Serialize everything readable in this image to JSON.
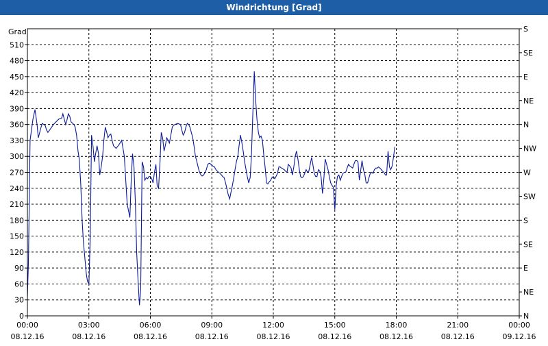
{
  "window": {
    "title": "Windrichtung [Grad]"
  },
  "colors": {
    "title_bar": "#1e5ea6",
    "line": "#0a1a9a",
    "grid": "#000000"
  },
  "chart_data": {
    "type": "line",
    "title": "Windrichtung [Grad]",
    "ylabel": "Grad",
    "ylim": [
      0,
      540
    ],
    "y_ticks": [
      0,
      30,
      60,
      90,
      120,
      150,
      180,
      210,
      240,
      270,
      300,
      330,
      360,
      390,
      420,
      450,
      480,
      510
    ],
    "y2_ticks": [
      {
        "value": 0,
        "label": "N"
      },
      {
        "value": 45,
        "label": "NE"
      },
      {
        "value": 90,
        "label": "E"
      },
      {
        "value": 135,
        "label": "SE"
      },
      {
        "value": 180,
        "label": "S"
      },
      {
        "value": 225,
        "label": "SW"
      },
      {
        "value": 270,
        "label": "W"
      },
      {
        "value": 315,
        "label": "NW"
      },
      {
        "value": 360,
        "label": "N"
      },
      {
        "value": 405,
        "label": "NE"
      },
      {
        "value": 450,
        "label": "E"
      },
      {
        "value": 495,
        "label": "SE"
      },
      {
        "value": 540,
        "label": "S"
      }
    ],
    "xlim": [
      0,
      24
    ],
    "x_ticks": [
      {
        "value": 0,
        "time": "00:00",
        "date": "08.12.16"
      },
      {
        "value": 3,
        "time": "03:00",
        "date": "08.12.16"
      },
      {
        "value": 6,
        "time": "06:00",
        "date": "08.12.16"
      },
      {
        "value": 9,
        "time": "09:00",
        "date": "08.12.16"
      },
      {
        "value": 12,
        "time": "12:00",
        "date": "08.12.16"
      },
      {
        "value": 15,
        "time": "15:00",
        "date": "08.12.16"
      },
      {
        "value": 18,
        "time": "18:00",
        "date": "08.12.16"
      },
      {
        "value": 21,
        "time": "21:00",
        "date": "08.12.16"
      },
      {
        "value": 24,
        "time": "00:00",
        "date": "09.12.16"
      }
    ],
    "grid": true,
    "series": [
      {
        "values": [
          [
            0.0,
            35
          ],
          [
            0.05,
            100
          ],
          [
            0.13,
            330
          ],
          [
            0.27,
            370
          ],
          [
            0.37,
            388
          ],
          [
            0.47,
            360
          ],
          [
            0.53,
            335
          ],
          [
            0.67,
            355
          ],
          [
            0.73,
            362
          ],
          [
            0.87,
            358
          ],
          [
            0.93,
            350
          ],
          [
            1.0,
            345
          ],
          [
            1.13,
            352
          ],
          [
            1.27,
            360
          ],
          [
            1.4,
            365
          ],
          [
            1.53,
            370
          ],
          [
            1.67,
            372
          ],
          [
            1.73,
            380
          ],
          [
            1.8,
            370
          ],
          [
            1.87,
            360
          ],
          [
            1.93,
            368
          ],
          [
            2.0,
            380
          ],
          [
            2.07,
            375
          ],
          [
            2.13,
            365
          ],
          [
            2.27,
            360
          ],
          [
            2.33,
            355
          ],
          [
            2.4,
            340
          ],
          [
            2.47,
            310
          ],
          [
            2.53,
            295
          ],
          [
            2.6,
            250
          ],
          [
            2.67,
            180
          ],
          [
            2.73,
            140
          ],
          [
            2.8,
            110
          ],
          [
            2.87,
            80
          ],
          [
            2.93,
            65
          ],
          [
            3.0,
            60
          ],
          [
            3.07,
            150
          ],
          [
            3.13,
            340
          ],
          [
            3.2,
            320
          ],
          [
            3.27,
            290
          ],
          [
            3.33,
            305
          ],
          [
            3.4,
            320
          ],
          [
            3.47,
            305
          ],
          [
            3.53,
            265
          ],
          [
            3.6,
            280
          ],
          [
            3.67,
            300
          ],
          [
            3.73,
            330
          ],
          [
            3.8,
            355
          ],
          [
            3.87,
            345
          ],
          [
            3.93,
            335
          ],
          [
            4.0,
            340
          ],
          [
            4.07,
            342
          ],
          [
            4.13,
            330
          ],
          [
            4.2,
            320
          ],
          [
            4.33,
            315
          ],
          [
            4.47,
            322
          ],
          [
            4.6,
            330
          ],
          [
            4.73,
            300
          ],
          [
            4.87,
            210
          ],
          [
            5.0,
            185
          ],
          [
            5.07,
            260
          ],
          [
            5.13,
            305
          ],
          [
            5.2,
            280
          ],
          [
            5.27,
            210
          ],
          [
            5.33,
            120
          ],
          [
            5.4,
            65
          ],
          [
            5.47,
            20
          ],
          [
            5.53,
            50
          ],
          [
            5.6,
            290
          ],
          [
            5.67,
            280
          ],
          [
            5.73,
            255
          ],
          [
            5.8,
            260
          ],
          [
            5.87,
            258
          ],
          [
            5.93,
            262
          ],
          [
            6.0,
            262
          ],
          [
            6.07,
            258
          ],
          [
            6.13,
            250
          ],
          [
            6.2,
            270
          ],
          [
            6.27,
            285
          ],
          [
            6.33,
            245
          ],
          [
            6.4,
            240
          ],
          [
            6.47,
            290
          ],
          [
            6.53,
            345
          ],
          [
            6.6,
            335
          ],
          [
            6.67,
            310
          ],
          [
            6.73,
            320
          ],
          [
            6.8,
            335
          ],
          [
            6.87,
            330
          ],
          [
            6.93,
            325
          ],
          [
            7.0,
            340
          ],
          [
            7.07,
            355
          ],
          [
            7.13,
            358
          ],
          [
            7.2,
            360
          ],
          [
            7.33,
            362
          ],
          [
            7.47,
            360
          ],
          [
            7.53,
            350
          ],
          [
            7.6,
            340
          ],
          [
            7.67,
            345
          ],
          [
            7.73,
            355
          ],
          [
            7.8,
            362
          ],
          [
            7.87,
            360
          ],
          [
            7.93,
            355
          ],
          [
            8.0,
            345
          ],
          [
            8.07,
            335
          ],
          [
            8.13,
            320
          ],
          [
            8.2,
            300
          ],
          [
            8.27,
            290
          ],
          [
            8.33,
            280
          ],
          [
            8.4,
            270
          ],
          [
            8.47,
            265
          ],
          [
            8.53,
            263
          ],
          [
            8.6,
            265
          ],
          [
            8.67,
            270
          ],
          [
            8.73,
            275
          ],
          [
            8.8,
            285
          ],
          [
            8.87,
            287
          ],
          [
            8.93,
            286
          ],
          [
            9.0,
            283
          ],
          [
            9.13,
            280
          ],
          [
            9.2,
            275
          ],
          [
            9.27,
            272
          ],
          [
            9.33,
            270
          ],
          [
            9.4,
            268
          ],
          [
            9.47,
            265
          ],
          [
            9.53,
            262
          ],
          [
            9.6,
            260
          ],
          [
            9.67,
            250
          ],
          [
            9.73,
            240
          ],
          [
            9.8,
            228
          ],
          [
            9.87,
            220
          ],
          [
            9.93,
            232
          ],
          [
            10.0,
            245
          ],
          [
            10.07,
            260
          ],
          [
            10.13,
            275
          ],
          [
            10.2,
            290
          ],
          [
            10.27,
            300
          ],
          [
            10.33,
            320
          ],
          [
            10.4,
            340
          ],
          [
            10.47,
            325
          ],
          [
            10.53,
            310
          ],
          [
            10.6,
            290
          ],
          [
            10.67,
            275
          ],
          [
            10.73,
            262
          ],
          [
            10.8,
            250
          ],
          [
            10.87,
            260
          ],
          [
            10.93,
            300
          ],
          [
            11.0,
            380
          ],
          [
            11.07,
            460
          ],
          [
            11.13,
            410
          ],
          [
            11.2,
            370
          ],
          [
            11.27,
            345
          ],
          [
            11.33,
            335
          ],
          [
            11.4,
            338
          ],
          [
            11.47,
            330
          ],
          [
            11.53,
            305
          ],
          [
            11.6,
            280
          ],
          [
            11.67,
            250
          ],
          [
            11.73,
            248
          ],
          [
            11.8,
            252
          ],
          [
            11.87,
            255
          ],
          [
            11.93,
            260
          ],
          [
            12.0,
            262
          ],
          [
            12.07,
            258
          ],
          [
            12.13,
            262
          ],
          [
            12.2,
            268
          ],
          [
            12.27,
            280
          ],
          [
            12.33,
            280
          ],
          [
            12.4,
            278
          ],
          [
            12.53,
            275
          ],
          [
            12.6,
            272
          ],
          [
            12.67,
            270
          ],
          [
            12.73,
            285
          ],
          [
            12.8,
            282
          ],
          [
            12.87,
            278
          ],
          [
            12.93,
            265
          ],
          [
            13.0,
            280
          ],
          [
            13.07,
            300
          ],
          [
            13.13,
            310
          ],
          [
            13.2,
            295
          ],
          [
            13.27,
            275
          ],
          [
            13.33,
            262
          ],
          [
            13.4,
            260
          ],
          [
            13.47,
            262
          ],
          [
            13.53,
            268
          ],
          [
            13.6,
            275
          ],
          [
            13.67,
            270
          ],
          [
            13.73,
            272
          ],
          [
            13.8,
            285
          ],
          [
            13.87,
            298
          ],
          [
            13.93,
            285
          ],
          [
            14.0,
            268
          ],
          [
            14.07,
            262
          ],
          [
            14.13,
            262
          ],
          [
            14.2,
            275
          ],
          [
            14.27,
            272
          ],
          [
            14.33,
            262
          ],
          [
            14.4,
            230
          ],
          [
            14.47,
            260
          ],
          [
            14.53,
            295
          ],
          [
            14.6,
            285
          ],
          [
            14.67,
            275
          ],
          [
            14.73,
            262
          ],
          [
            14.8,
            250
          ],
          [
            14.87,
            245
          ],
          [
            14.93,
            242
          ],
          [
            15.0,
            200
          ],
          [
            15.07,
            245
          ],
          [
            15.13,
            262
          ],
          [
            15.2,
            265
          ],
          [
            15.27,
            255
          ],
          [
            15.33,
            262
          ],
          [
            15.4,
            268
          ],
          [
            15.47,
            270
          ],
          [
            15.53,
            270
          ],
          [
            15.6,
            278
          ],
          [
            15.67,
            285
          ],
          [
            15.73,
            282
          ],
          [
            15.8,
            280
          ],
          [
            15.87,
            278
          ],
          [
            15.93,
            285
          ],
          [
            16.0,
            292
          ],
          [
            16.07,
            292
          ],
          [
            16.13,
            290
          ],
          [
            16.2,
            255
          ],
          [
            16.27,
            275
          ],
          [
            16.33,
            292
          ],
          [
            16.4,
            275
          ],
          [
            16.47,
            265
          ],
          [
            16.53,
            250
          ],
          [
            16.6,
            250
          ],
          [
            16.67,
            260
          ],
          [
            16.73,
            268
          ],
          [
            16.8,
            270
          ],
          [
            16.87,
            268
          ],
          [
            16.93,
            275
          ],
          [
            17.0,
            278
          ],
          [
            17.07,
            278
          ],
          [
            17.13,
            280
          ],
          [
            17.2,
            278
          ],
          [
            17.27,
            275
          ],
          [
            17.33,
            272
          ],
          [
            17.4,
            270
          ],
          [
            17.47,
            265
          ],
          [
            17.53,
            265
          ],
          [
            17.6,
            310
          ],
          [
            17.67,
            280
          ],
          [
            17.73,
            275
          ],
          [
            17.8,
            282
          ],
          [
            17.87,
            300
          ],
          [
            17.93,
            318
          ]
        ]
      }
    ]
  }
}
